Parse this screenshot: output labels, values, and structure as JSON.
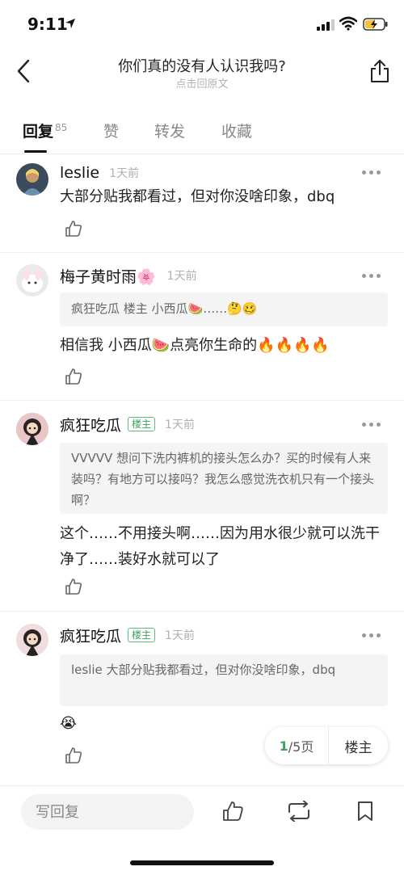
{
  "status": {
    "time": "9:11"
  },
  "nav": {
    "title": "你们真的没有人认识我吗?",
    "subtitle": "点击回原文"
  },
  "tabs": [
    {
      "label": "回复",
      "count": "85"
    },
    {
      "label": "赞"
    },
    {
      "label": "转发"
    },
    {
      "label": "收藏"
    }
  ],
  "comments": [
    {
      "user": "leslie",
      "time": "1天前",
      "text": "大部分贴我都看过，但对你没啥印象，dbq"
    },
    {
      "user": "梅子黄时雨🌸",
      "time": "1天前",
      "quote": "疯狂吃瓜 楼主 小西瓜🍉……🤔🥴",
      "text": "相信我 小西瓜🍉点亮你生命的🔥🔥🔥🔥"
    },
    {
      "user": "疯狂吃瓜",
      "badge": "楼主",
      "time": "1天前",
      "quote": "VVVVV 想问下洗内裤机的接头怎么办？买的时候有人来装吗？有地方可以接吗？我怎么感觉洗衣机只有一个接头啊？",
      "text": "这个……不用接头啊……因为用水很少就可以洗干净了……装好水就可以了"
    },
    {
      "user": "疯狂吃瓜",
      "badge": "楼主",
      "time": "1天前",
      "quote": "leslie 大部分贴我都看过，但对你没啥印象，dbq",
      "text": "😭"
    }
  ],
  "pager": {
    "current": "1",
    "total": "/5页",
    "owner_label": "楼主"
  },
  "bottom": {
    "reply_placeholder": "写回复"
  },
  "colors": {
    "accent_green": "#3aa35b",
    "owner_badge": "#5fbc7a"
  },
  "icons": [
    "location-arrow-icon",
    "signal-icon",
    "wifi-icon",
    "battery-charging-icon",
    "back-chevron-icon",
    "share-icon",
    "more-dots-icon",
    "thumbs-up-icon",
    "repost-icon",
    "bookmark-icon"
  ]
}
